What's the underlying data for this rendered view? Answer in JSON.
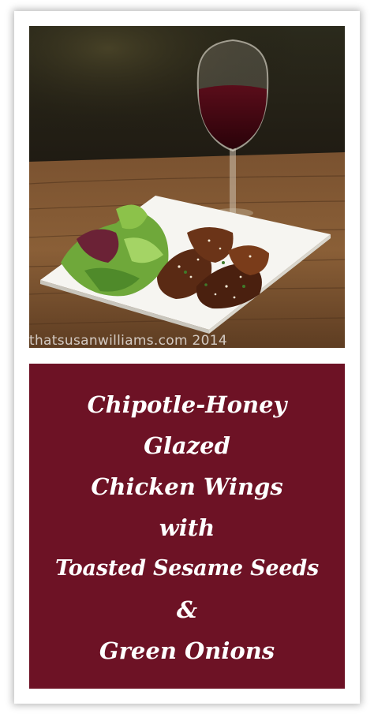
{
  "photo": {
    "alt_subject": "chicken wings on white plate with salad and glass of red wine",
    "watermark": "thatsusanwilliams.com 2014"
  },
  "title": {
    "lines": [
      "Chipotle-Honey",
      "Glazed",
      "Chicken Wings",
      "with",
      "Toasted Sesame Seeds",
      "&",
      "Green Onions"
    ]
  },
  "colors": {
    "panel_background": "#6d1225",
    "title_text": "#ffffff",
    "card_background": "#ffffff"
  }
}
